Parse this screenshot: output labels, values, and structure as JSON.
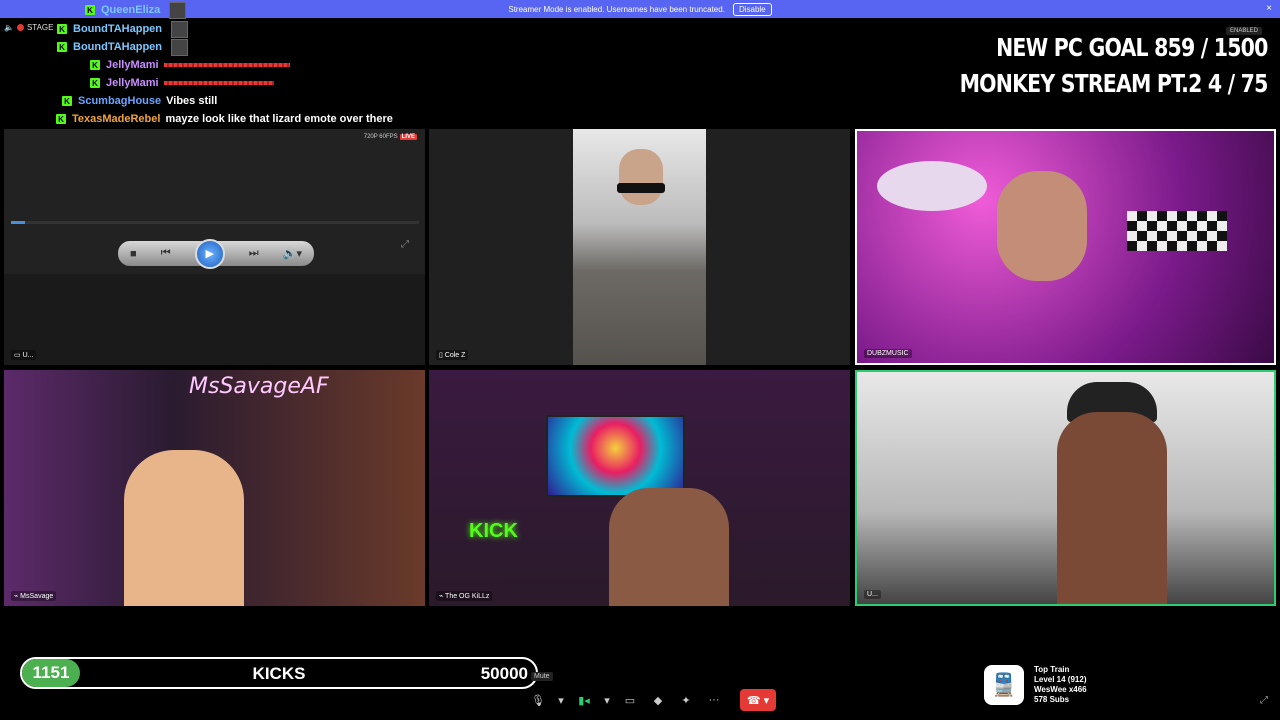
{
  "banner": {
    "text": "Streamer Mode is enabled. Usernames have been truncated.",
    "button": "Disable",
    "close": "×"
  },
  "stage": {
    "label": "STAGE"
  },
  "chat": [
    {
      "user": "QueenEliza",
      "color": "#7ac7ff",
      "msg": "",
      "type": "avatar"
    },
    {
      "user": "BoundTAHappen",
      "color": "#7ac7ff",
      "msg": "",
      "type": "avatar"
    },
    {
      "user": "BoundTAHappen",
      "color": "#7ac7ff",
      "msg": "",
      "type": "avatar"
    },
    {
      "user": "JellyMami",
      "color": "#c98cff",
      "msg": "",
      "type": "redbar"
    },
    {
      "user": "JellyMami",
      "color": "#c98cff",
      "msg": "",
      "type": "redbar"
    },
    {
      "user": "ScumbagHouse",
      "color": "#6ba3ff",
      "msg": "Vibes still",
      "type": "text"
    },
    {
      "user": "TexasMadeRebel",
      "color": "#f0a43a",
      "msg": "mayze look like that lizard emote over there",
      "type": "text"
    }
  ],
  "goals": {
    "line1": "NEW PC GOAL  859 / 1500",
    "line2": "MONKEY STREAM PT.2  4 / 75",
    "enabled": "ENABLED"
  },
  "tiles": [
    {
      "name": "U...",
      "icon": "monitor-icon",
      "badge": "720P 60FPS",
      "live": "LIVE"
    },
    {
      "name": "Cole Z",
      "icon": "phone-icon"
    },
    {
      "name": "DUBZMUSIC",
      "icon": ""
    },
    {
      "name": "MsSavage",
      "icon": "broadcast-icon"
    },
    {
      "name": "The OG KiLLz",
      "icon": "broadcast-icon"
    },
    {
      "name": "U...",
      "icon": ""
    }
  ],
  "kicks": {
    "current": "1151",
    "label": "KICKS",
    "target": "50000"
  },
  "mute_tooltip": "Mute",
  "train": {
    "title": "Top Train",
    "level": "Level 14 (912)",
    "user": "WesWee x466",
    "subs": "578 Subs"
  },
  "colors": {
    "banner": "#5865f2",
    "kick_green": "#53fc18",
    "end_call": "#e53935"
  }
}
